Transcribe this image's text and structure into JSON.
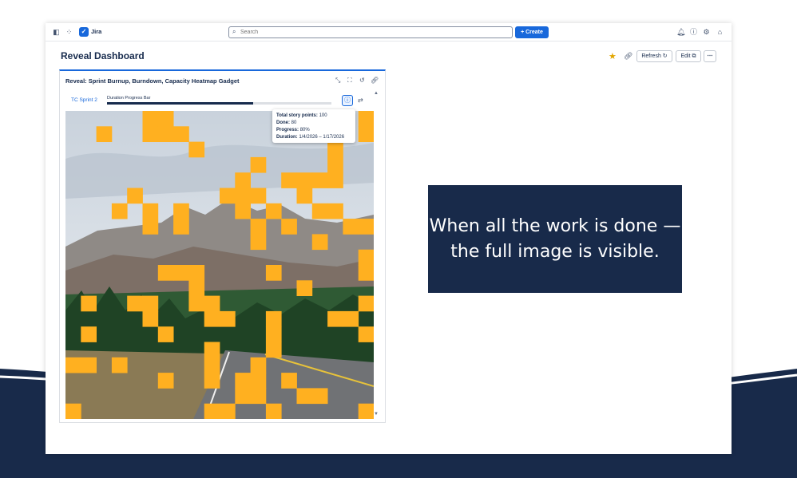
{
  "colors": {
    "navy": "#182a4a",
    "brand": "#1868db",
    "tile": "#ffb020"
  },
  "topbar": {
    "app_name": "Jira",
    "search_placeholder": "Search",
    "create_label": "+ Create"
  },
  "page": {
    "title": "Reveal Dashboard",
    "refresh_label": "Refresh",
    "edit_label": "Edit"
  },
  "gadget": {
    "title": "Reveal: Sprint Burnup, Burndown, Capacity Heatmap Gadget",
    "sprint_tab": "TC Sprint 2",
    "progress_label": "Duration Progress Bar",
    "duration_progress": 0.65,
    "tooltip": {
      "total_label": "Total story points:",
      "total_value": "100",
      "done_label": "Done:",
      "done_value": "80",
      "progress_label": "Progress:",
      "progress_value": "80%",
      "duration_label": "Duration:",
      "duration_value": "1/4/2026 – 1/17/2026"
    }
  },
  "callout": {
    "text": "When all the work is done — the full image is visible."
  }
}
